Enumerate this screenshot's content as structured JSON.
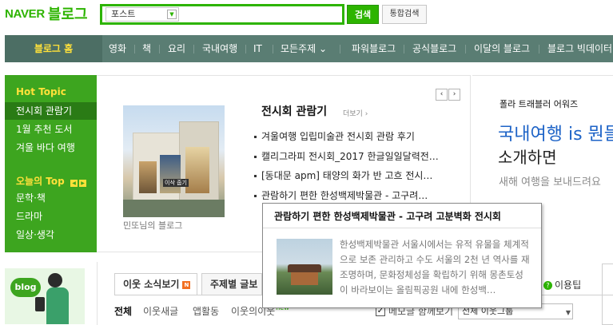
{
  "header": {
    "logo_naver": "NAVER",
    "logo_blog": "블로그",
    "search_scope": "포스트",
    "search_value": "",
    "search_button": "검색",
    "integrated_search_button": "통합검색"
  },
  "nav": {
    "home": "블로그 홈",
    "items": [
      "영화",
      "책",
      "요리",
      "국내여행",
      "IT",
      "모든주제 ⌄"
    ],
    "items_right": [
      "파워블로그",
      "공식블로그",
      "이달의 블로그",
      "블로그 빅데이터"
    ]
  },
  "hot_topic": {
    "title": "Hot Topic",
    "items": [
      "전시회 관람기",
      "1월 추천 도서",
      "겨울 바다 여행"
    ],
    "today_title": "오늘의 Top",
    "today_items": [
      "문학·책",
      "드라마",
      "일상·생각"
    ]
  },
  "card": {
    "heading": "전시회 관람기",
    "more": "더보기 ›",
    "image_caption": "민또님의 블로그",
    "image_label": "이삭 줍기",
    "list": [
      "겨울여행 입립미술관 전시회 관람 후기",
      "캘리그라피 전시회_2017 한글일일달력전…",
      "[동대문 apm] 태양의 화가 반 고흐 전시…",
      "관람하기 편한 한성백제박물관 - 고구려…"
    ],
    "pager_prev": "‹",
    "pager_next": "›"
  },
  "ad": {
    "brand": "폴라 트래블러 어워즈",
    "line1": "국내여행 is 뭔들",
    "line2": "소개하면",
    "line3": "새해 여행을 보내드려요"
  },
  "popup": {
    "title": "관람하기 편한 한성백제박물관 - 고구려 고분벽화 전시회",
    "text": "한성백제박물관 서울시에서는 유적 유물을 체계적으로 보존 관리하고 수도 서울의 2천 년 역사를 재조명하며, 문화정체성을 확립하기 위해 몽촌토성이 바라보이는 올림픽공원 내에 한성백…"
  },
  "lower": {
    "promo_badge": "blog",
    "tabs": [
      {
        "label": "이웃 소식보기",
        "badge": "N"
      },
      {
        "label": "주제별 글보"
      }
    ],
    "sub_tabs": [
      "전체",
      "이웃새글",
      "앱활동",
      "이웃의이웃"
    ],
    "sub_new": "new",
    "together_label": "메모글 함께보기",
    "together_checked": "✓",
    "group_select": "전체 이웃그룹",
    "tip": "이용팁",
    "tip_icon": "?"
  }
}
